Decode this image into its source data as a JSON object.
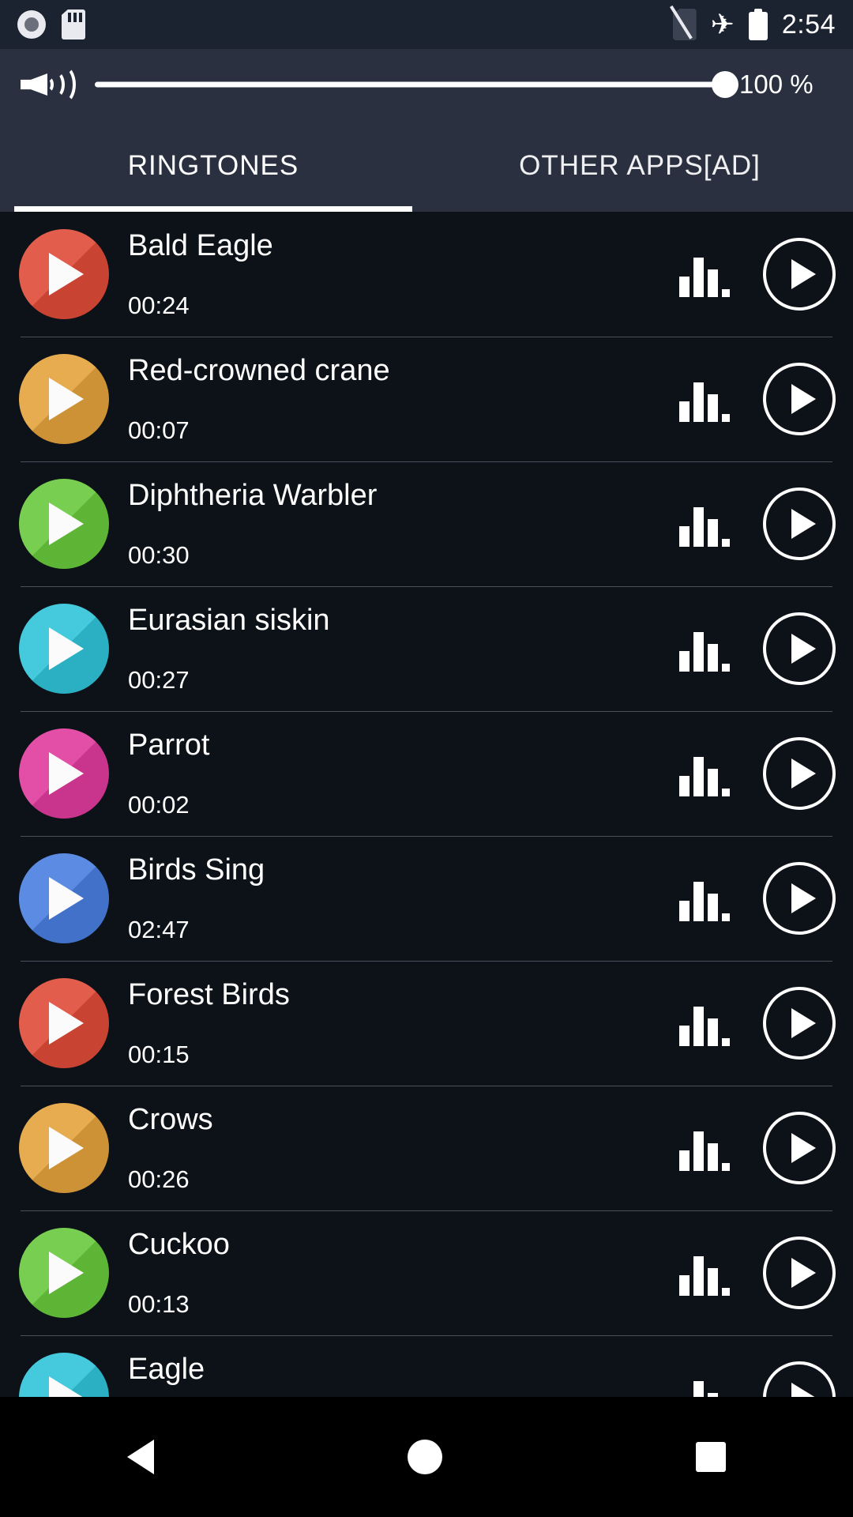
{
  "status_bar": {
    "time": "2:54",
    "icons": [
      "record-icon",
      "sd-card-icon",
      "no-sim-icon",
      "airplane-mode-icon",
      "battery-icon"
    ],
    "airplane_glyph": "✈",
    "background": "#1b2230"
  },
  "volume": {
    "speaker_icon": "speaker-volume-icon",
    "level_percent": 100,
    "level_label": "100 %",
    "background": "#2a3040"
  },
  "tabs": [
    {
      "label": "RINGTONES",
      "active": true
    },
    {
      "label": "OTHER APPS[AD]",
      "active": false
    }
  ],
  "list": {
    "background": "#0d1218",
    "divider_color": "#4a4f5c",
    "rows": [
      {
        "title": "Bald Eagle",
        "duration": "00:24",
        "color": "#e04b38"
      },
      {
        "title": "Red-crowned crane",
        "duration": "00:07",
        "color": "#e5a33c"
      },
      {
        "title": "Diphtheria Warbler",
        "duration": "00:30",
        "color": "#68c93c"
      },
      {
        "title": "Eurasian siskin",
        "duration": "00:27",
        "color": "#2fc4d8"
      },
      {
        "title": "Parrot",
        "duration": "00:02",
        "color": "#e03a9c"
      },
      {
        "title": "Birds Sing",
        "duration": "02:47",
        "color": "#4a7ee0"
      },
      {
        "title": "Forest Birds",
        "duration": "00:15",
        "color": "#e04b38"
      },
      {
        "title": "Crows",
        "duration": "00:26",
        "color": "#e5a33c"
      },
      {
        "title": "Cuckoo",
        "duration": "00:13",
        "color": "#68c93c"
      },
      {
        "title": "Eagle",
        "duration": "",
        "color": "#2fc4d8"
      }
    ]
  },
  "nav_bar": {
    "background": "#000000",
    "buttons": [
      "back-button",
      "home-button",
      "recents-button"
    ]
  }
}
